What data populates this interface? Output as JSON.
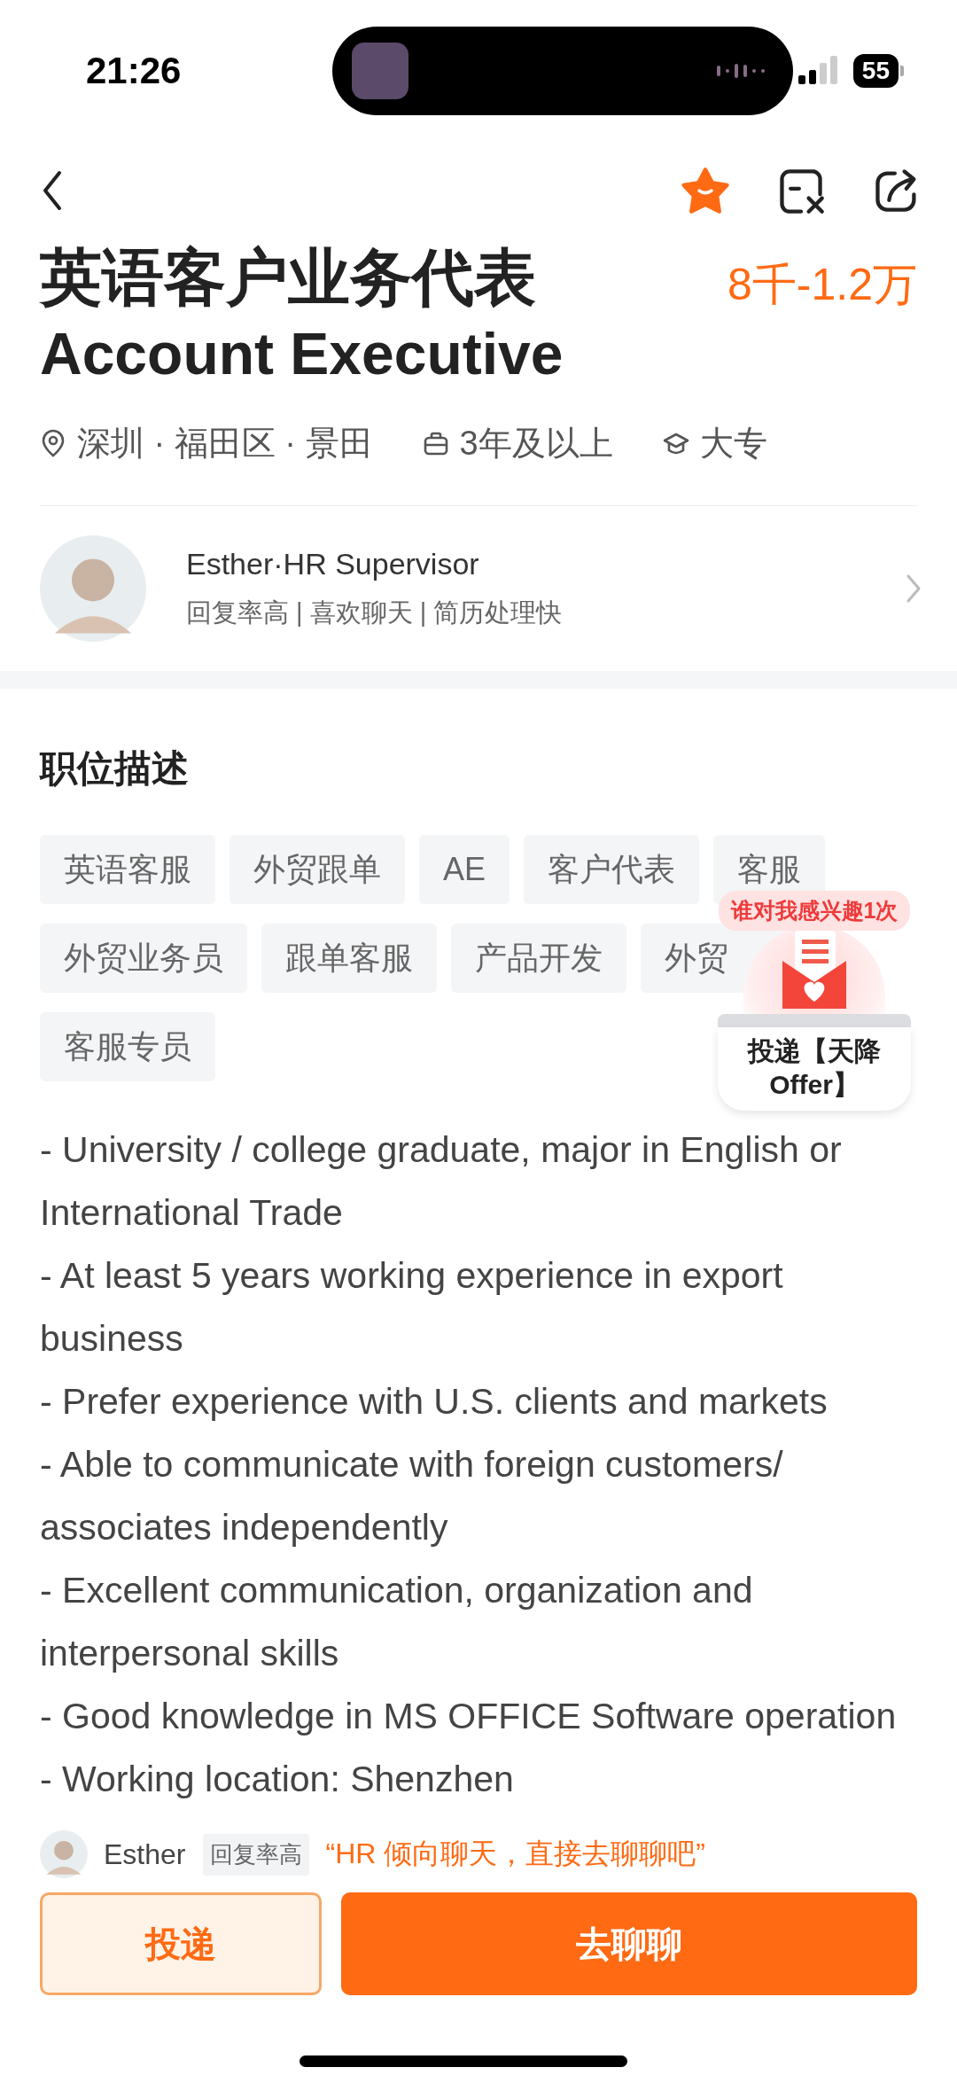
{
  "status_bar": {
    "time": "21:26",
    "battery": "55"
  },
  "job": {
    "title_cn": "英语客户业务代表",
    "title_en": "Account Executive",
    "salary": "8千-1.2万",
    "meta": [
      {
        "kind": "location",
        "text": "深圳 · 福田区 · 景田"
      },
      {
        "kind": "experience",
        "text": "3年及以上"
      },
      {
        "kind": "education",
        "text": "大专"
      }
    ]
  },
  "recruiter": {
    "name": "Esther·HR Supervisor",
    "traits": "回复率高 | 喜欢聊天 | 简历处理快"
  },
  "description": {
    "heading": "职位描述",
    "tags": [
      "英语客服",
      "外贸跟单",
      "AE",
      "客户代表",
      "客服",
      "外贸业务员",
      "跟单客服",
      "产品开发",
      "外贸",
      "客服专员"
    ],
    "lines": [
      "- University / college graduate, major in English or International Trade",
      "- At least 5 years working experience in export business",
      "- Prefer experience with U.S. clients and markets",
      "- Able to communicate with foreign customers/ associates independently",
      "- Excellent communication, organization and interpersonal skills",
      "- Good knowledge in MS OFFICE Software operation",
      "- Working location: Shenzhen"
    ]
  },
  "promo": {
    "badge": "谁对我感兴趣1次",
    "label": "投递【天降Offer】"
  },
  "bottom_bar": {
    "name": "Esther",
    "badge": "回复率高",
    "hint": "“HR 倾向聊天，直接去聊聊吧”",
    "buttons": [
      {
        "kind": "secondary",
        "label": "投递"
      },
      {
        "kind": "primary",
        "label": "去聊聊"
      }
    ]
  }
}
